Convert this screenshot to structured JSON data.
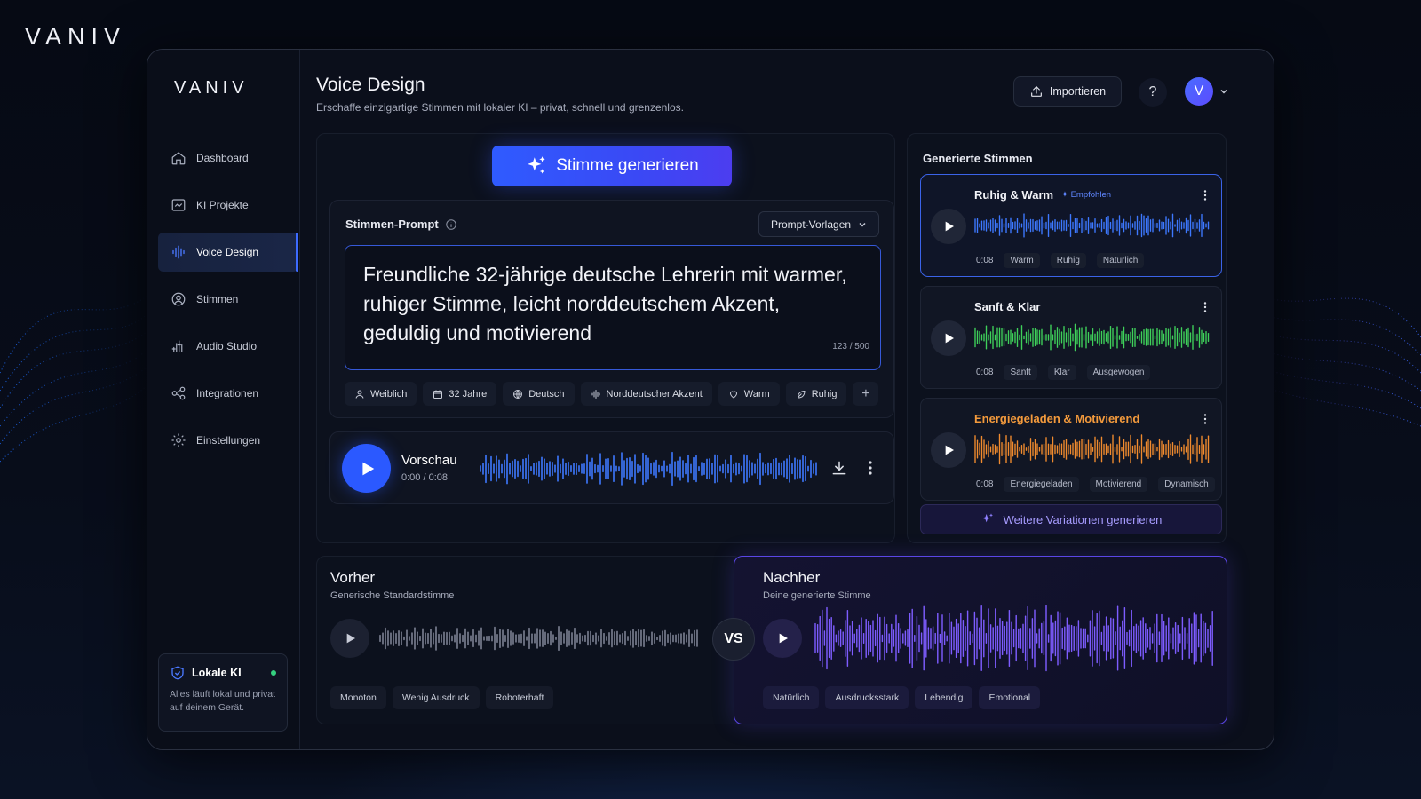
{
  "outer_brand": "VANIV",
  "sidebar": {
    "brand": "VANIV",
    "items": [
      {
        "label": "Dashboard",
        "icon": "home-icon"
      },
      {
        "label": "KI Projekte",
        "icon": "project-icon"
      },
      {
        "label": "Voice Design",
        "icon": "waveform-icon",
        "active": true
      },
      {
        "label": "Stimmen",
        "icon": "user-circle-icon"
      },
      {
        "label": "Audio Studio",
        "icon": "equalizer-icon"
      },
      {
        "label": "Integrationen",
        "icon": "integrations-icon"
      },
      {
        "label": "Einstellungen",
        "icon": "gear-icon"
      }
    ],
    "local_ai": {
      "title": "Lokale KI",
      "desc": "Alles läuft lokal und privat auf deinem Gerät.",
      "status_color": "#35d07f"
    }
  },
  "header": {
    "title": "Voice Design",
    "subtitle": "Erschaffe einzigartige Stimmen mit lokaler KI – privat, schnell und grenzenlos.",
    "import_label": "Importieren",
    "help_label": "?",
    "avatar_letter": "V"
  },
  "generate_button": "Stimme generieren",
  "prompt": {
    "label": "Stimmen-Prompt",
    "templates_label": "Prompt-Vorlagen",
    "text": "Freundliche 32-jährige deutsche Lehrerin mit warmer, ruhiger Stimme, leicht norddeutschem Akzent, geduldig und motivierend",
    "counter": "123 / 500",
    "tags": [
      {
        "label": "Weiblich",
        "icon": "person-icon"
      },
      {
        "label": "32 Jahre",
        "icon": "calendar-icon"
      },
      {
        "label": "Deutsch",
        "icon": "globe-icon"
      },
      {
        "label": "Norddeutscher Akzent",
        "icon": "waveform-icon"
      },
      {
        "label": "Warm",
        "icon": "heart-icon"
      },
      {
        "label": "Ruhig",
        "icon": "leaf-icon"
      }
    ],
    "add_tag_label": "+"
  },
  "preview": {
    "title": "Vorschau",
    "time": "0:00 / 0:08"
  },
  "generated": {
    "title": "Generierte Stimmen",
    "voices": [
      {
        "name": "Ruhig & Warm",
        "badge": "✦ Empfohlen",
        "duration": "0:08",
        "tags": [
          "Warm",
          "Ruhig",
          "Natürlich"
        ],
        "color": "#3d78ff",
        "name_color": "#f2f3f8"
      },
      {
        "name": "Sanft & Klar",
        "badge": "",
        "duration": "0:08",
        "tags": [
          "Sanft",
          "Klar",
          "Ausgewogen"
        ],
        "color": "#3fd05a",
        "name_color": "#f2f3f8"
      },
      {
        "name": "Energiegeladen & Motivierend",
        "badge": "",
        "duration": "0:08",
        "tags": [
          "Energiegeladen",
          "Motivierend",
          "Dynamisch"
        ],
        "color": "#f08a2e",
        "name_color": "#f39a3c"
      }
    ],
    "more_label": "Weitere Variationen generieren"
  },
  "compare": {
    "before": {
      "title": "Vorher",
      "subtitle": "Generische Standardstimme",
      "tags": [
        "Monoton",
        "Wenig Ausdruck",
        "Roboterhaft"
      ]
    },
    "vs": "VS",
    "after": {
      "title": "Nachher",
      "subtitle": "Deine generierte Stimme",
      "tags": [
        "Natürlich",
        "Ausdrucksstark",
        "Lebendig",
        "Emotional"
      ]
    }
  },
  "colors": {
    "accent": "#2f5bff",
    "purple": "#5a46e6",
    "bg": "#0b0f1b"
  }
}
